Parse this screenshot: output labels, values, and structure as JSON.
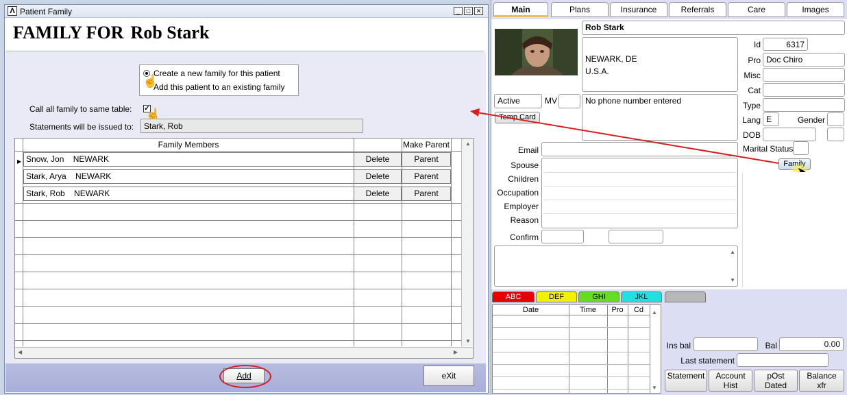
{
  "window": {
    "title": "Patient Family",
    "heading_prefix": "FAMILY FOR",
    "heading_name": "Rob Stark",
    "options": {
      "new_family": "Create a new family for this patient",
      "existing_family": "Add this patient to an existing family"
    },
    "same_table_label": "Call all family to same table:",
    "same_table_checked": "✓",
    "statements_label": "Statements will be issued to:",
    "statements_value": "Stark, Rob",
    "grid": {
      "col_members": "Family Members",
      "col_make_parent": "Make Parent",
      "delete_label": "Delete",
      "parent_label": "Parent",
      "rows": [
        {
          "name": "Snow, Jon",
          "city": "NEWARK"
        },
        {
          "name": "Stark, Arya",
          "city": "NEWARK"
        },
        {
          "name": "Stark, Rob",
          "city": "NEWARK"
        }
      ]
    },
    "add_label": "Add",
    "exit_label": "eXit"
  },
  "tabs": [
    "Main",
    "Plans",
    "Insurance",
    "Referrals",
    "Care",
    "Images"
  ],
  "patient": {
    "name": "Rob Stark",
    "address_line1": "NEWARK, DE",
    "address_line2": "U.S.A.",
    "phone_text": "No phone  number entered",
    "status": "Active",
    "mv_label": "MV",
    "temp_card_label": "Temp Card",
    "id_label": "Id",
    "id_value": "6317",
    "pro_label": "Pro",
    "pro_value": "Doc Chiro",
    "misc_label": "Misc",
    "cat_label": "Cat",
    "type_label": "Type",
    "lang_label": "Lang",
    "lang_value": "E",
    "gender_label": "Gender",
    "dob_label": "DOB",
    "marital_label": "Marital Status",
    "family_button": "Family",
    "email_label": "Email",
    "spouse_label": "Spouse",
    "children_label": "Children",
    "occupation_label": "Occupation",
    "employer_label": "Employer",
    "reason_label": "Reason",
    "confirm_label": "Confirm"
  },
  "color_tabs": [
    {
      "label": "ABC",
      "color": "#e80000",
      "text": "#ffffff"
    },
    {
      "label": "DEF",
      "color": "#f2f200",
      "text": "#000000"
    },
    {
      "label": "GHI",
      "color": "#66dd22",
      "text": "#000000"
    },
    {
      "label": "JKL",
      "color": "#22e0e0",
      "text": "#000000"
    },
    {
      "label": "",
      "color": "#b8b8b8",
      "text": "#000000"
    }
  ],
  "ledger": {
    "col_date": "Date",
    "col_time": "Time",
    "col_pro": "Pro",
    "col_cd": "Cd"
  },
  "balances": {
    "ins_bal_label": "Ins bal",
    "bal_label": "Bal",
    "bal_value": "0.00",
    "last_statement_label": "Last statement"
  },
  "bottom_buttons": {
    "statement": "Statement",
    "account_hist_1": "Account",
    "account_hist_2": "Hist",
    "post_dated_1": "pOst",
    "post_dated_2": "Dated",
    "balance_xfr_1": "Balance",
    "balance_xfr_2": "xfr"
  },
  "accent_colors": {
    "annotation_red": "#d61f1f",
    "panel_lavender": "#dcdff4",
    "bottom_bar": "#aab0da"
  }
}
